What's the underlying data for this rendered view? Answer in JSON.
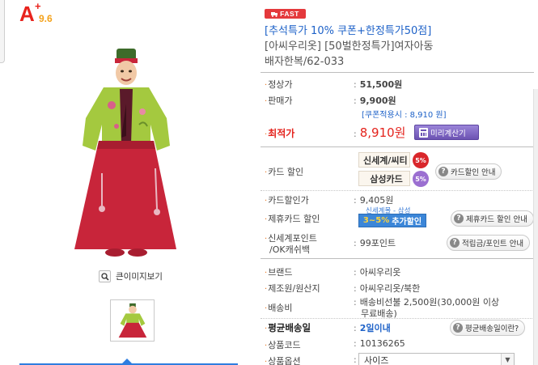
{
  "grade": {
    "letter": "A",
    "plus": "+",
    "score": "9.6"
  },
  "enlarge_label": "큰이미지보기",
  "fast_badge": "FAST",
  "title": {
    "promo": "[추석특가 10% 쿠폰+한정특가50점]",
    "line1": "[아씨우리옷] [50벌한정특가]여자아동",
    "line2": "배자한복/62-033"
  },
  "prices": {
    "list_label": "정상가",
    "list_value": "51,500원",
    "sale_label": "판매가",
    "sale_value": "9,900원",
    "coupon_note": "[쿠폰적용시 : 8,910 원]",
    "best_label": "최적가",
    "best_value": "8,910원",
    "calc_button": "미리계산기"
  },
  "card_discount": {
    "label": "카드 할인",
    "cards": [
      {
        "name": "신세계/씨티",
        "pct": "5%",
        "color": "#d9262b"
      },
      {
        "name": "삼성카드",
        "pct": "5%",
        "color": "#9b6fd1"
      }
    ],
    "info_button": "카드할인 안내"
  },
  "card_price": {
    "label": "카드할인가",
    "value": "9,405원"
  },
  "partner_card": {
    "label": "제휴카드 할인",
    "top_text": "신세계몰 - 삼성",
    "button_highlight": "3~5%",
    "button_text": "추가할인",
    "info_button": "제휴카드 할인 안내"
  },
  "points": {
    "label_line1": "신세계포인트",
    "label_line2": "/OK캐쉬백",
    "value": "99포인트",
    "info_button": "적립금/포인트 안내"
  },
  "details": {
    "brand_label": "브랜드",
    "brand_value": "아씨우리옷",
    "maker_label": "제조원/원산지",
    "maker_value": "아씨우리옷/북한",
    "shipping_label": "배송비",
    "shipping_value_line1": "배송비선불 2,500원(30,000원 이상",
    "shipping_value_line2": "무료배송)",
    "avg_label": "평균배송일",
    "avg_value": "2일이내",
    "avg_button": "평균배송일이란?",
    "code_label": "상품코드",
    "code_value": "10136265",
    "option_label": "상품옵션",
    "option_value": "사이즈"
  },
  "colors": {
    "accent_red": "#e4231d",
    "link_blue": "#1e62c8",
    "hanbok_jacket": "#a4c93f",
    "hanbok_skirt": "#c8253a",
    "calc_purple": "#6c53b3"
  }
}
